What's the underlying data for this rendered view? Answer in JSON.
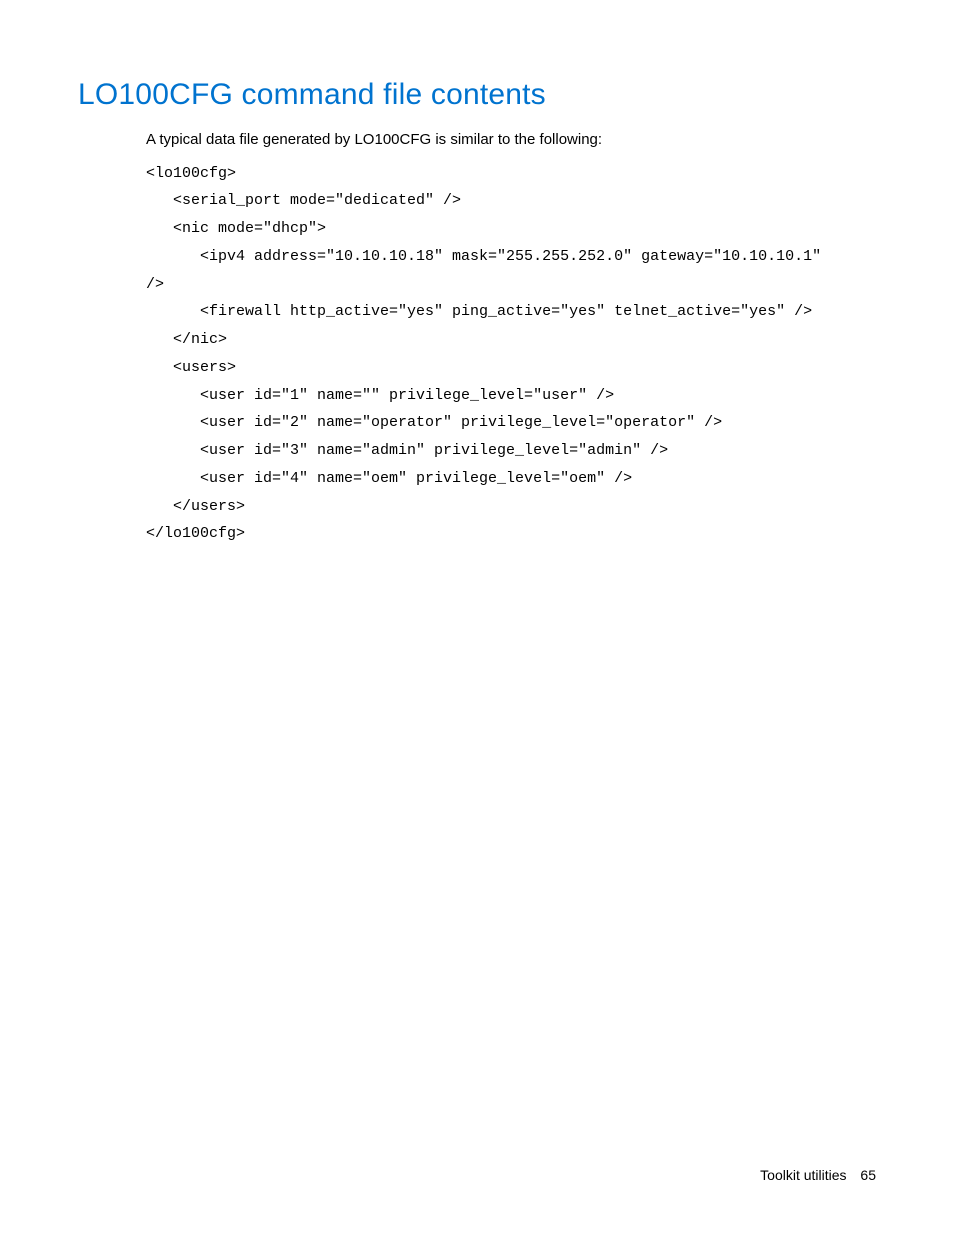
{
  "heading": "LO100CFG command file contents",
  "intro": "A typical data file generated by LO100CFG is similar to the following:",
  "code": "<lo100cfg>\n   <serial_port mode=\"dedicated\" />\n   <nic mode=\"dhcp\">\n      <ipv4 address=\"10.10.10.18\" mask=\"255.255.252.0\" gateway=\"10.10.10.1\"\n/>\n      <firewall http_active=\"yes\" ping_active=\"yes\" telnet_active=\"yes\" />\n   </nic>\n   <users>\n      <user id=\"1\" name=\"\" privilege_level=\"user\" />\n      <user id=\"2\" name=\"operator\" privilege_level=\"operator\" />\n      <user id=\"3\" name=\"admin\" privilege_level=\"admin\" />\n      <user id=\"4\" name=\"oem\" privilege_level=\"oem\" />\n   </users>\n</lo100cfg>",
  "footer": {
    "section": "Toolkit utilities",
    "page": "65"
  }
}
